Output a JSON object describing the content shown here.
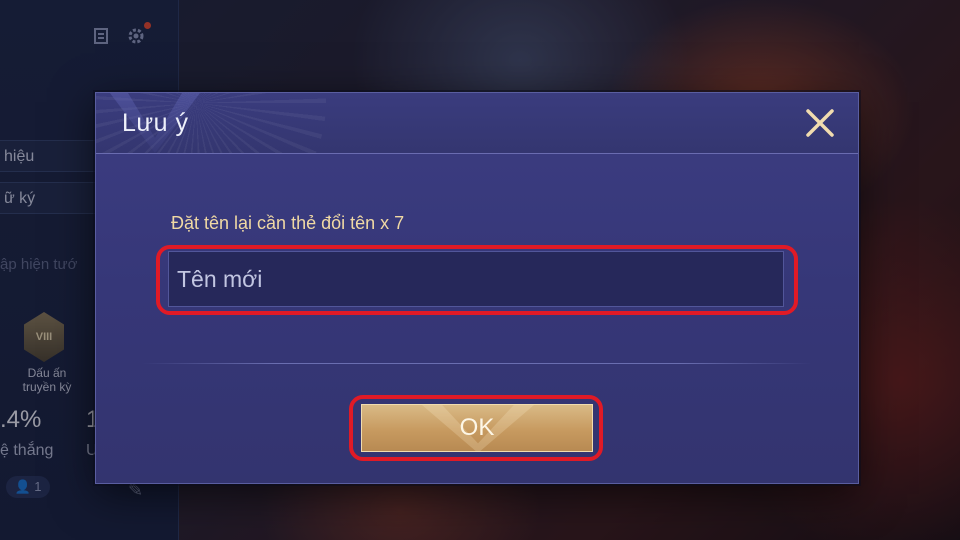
{
  "background": {
    "profile_panel": {
      "rows": [
        "hiệu",
        "ữ ký"
      ],
      "faded_text": "ập hiện tướ",
      "badge_text": "VIII",
      "badge_label_line1": "Dấu ấn",
      "badge_label_line2": "truyền kỳ",
      "stats": [
        {
          "value": ".4%",
          "label": "ệ thắng"
        },
        {
          "value": "1",
          "label": "U"
        }
      ],
      "friends_count": "1",
      "icons": [
        "menu-icon",
        "gear-icon",
        "person-icon",
        "pen-icon"
      ]
    }
  },
  "dialog": {
    "title": "Lưu ý",
    "close_icon": "close-icon",
    "hint": "Đặt tên lại cần thẻ đổi tên x 7",
    "input": {
      "placeholder": "Tên mới",
      "value": ""
    },
    "ok_label": "OK"
  },
  "colors": {
    "highlight": "#e01a26",
    "hint_text": "#f0d9a4",
    "ok_button": "#c79a60",
    "dialog_bg": "#363778"
  }
}
